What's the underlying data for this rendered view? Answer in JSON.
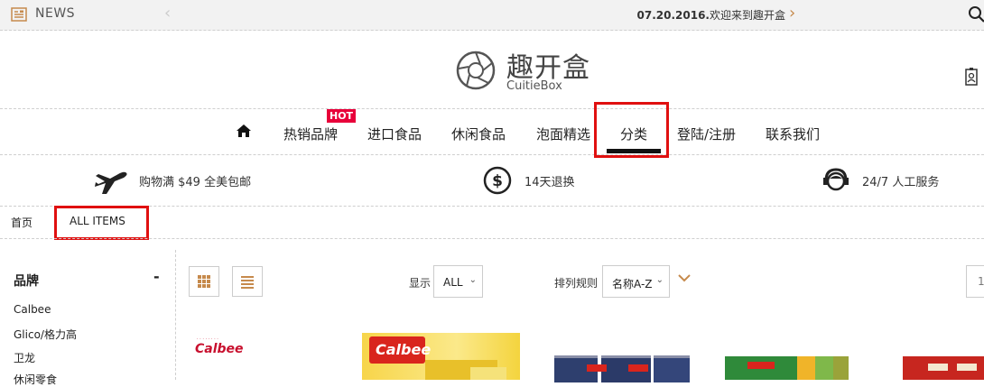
{
  "topbar": {
    "news_label": "NEWS",
    "news_date": "07.20.2016.",
    "news_text": "欢迎来到趣开盒"
  },
  "logo": {
    "cn": "趣开盒",
    "en": "CuitieBox"
  },
  "nav": {
    "items": [
      "热销品牌",
      "进口食品",
      "休闲食品",
      "泡面精选",
      "分类",
      "登陆/注册",
      "联系我们"
    ],
    "hot_badge": "HOT"
  },
  "features": [
    {
      "icon": "airplane-icon",
      "text": "购物满 $49 全美包邮"
    },
    {
      "icon": "dollar-icon",
      "text": "14天退换"
    },
    {
      "icon": "support-agent-icon",
      "text": "24/7 人工服务"
    }
  ],
  "breadcrumb": {
    "home": "首页",
    "current": "ALL ITEMS"
  },
  "sidebar": {
    "title": "品牌",
    "toggle": "-",
    "items": [
      "Calbee",
      "Glico/格力高",
      "卫龙",
      "休闲零食"
    ]
  },
  "toolbar": {
    "show_label": "显示",
    "show_value": "ALL",
    "sort_label": "排列规则",
    "sort_value": "名称A-Z",
    "page_value": "1"
  },
  "products": {
    "brand_text": "Calbee"
  },
  "colors": {
    "accent": "#c68a4c",
    "highlight": "#e01010",
    "hot": "#e8003a"
  }
}
